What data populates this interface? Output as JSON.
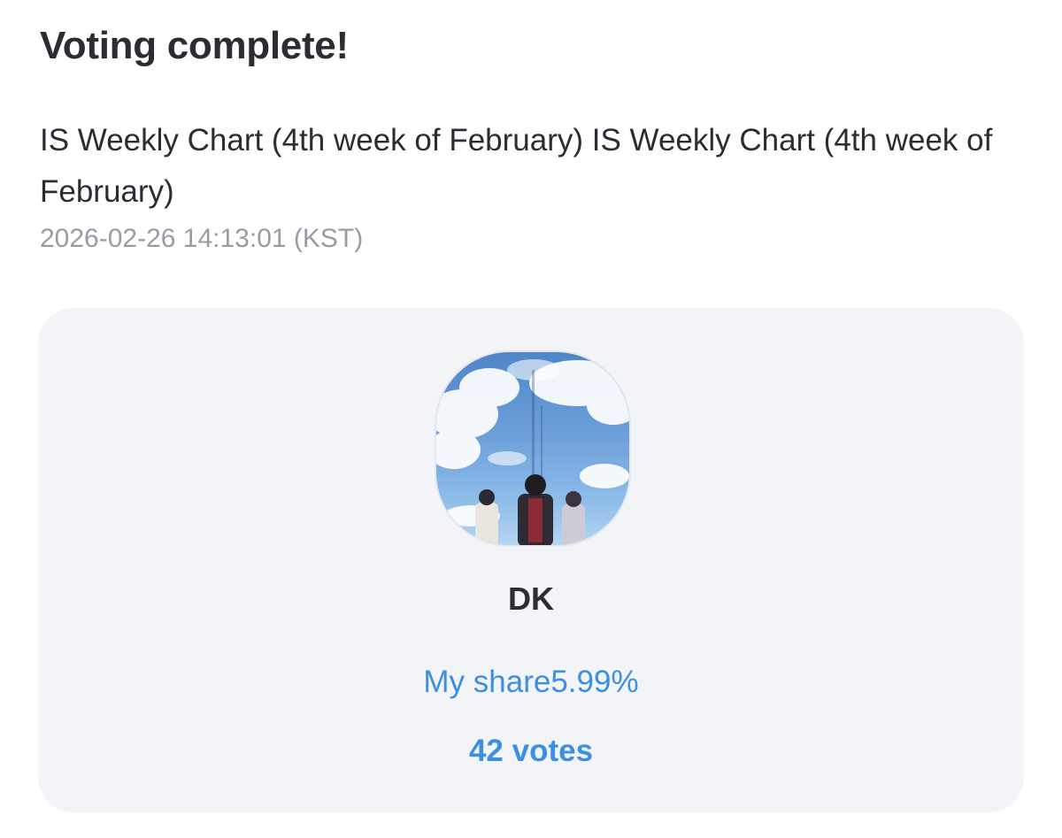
{
  "header": {
    "title": "Voting complete!"
  },
  "poll": {
    "title": "IS Weekly Chart (4th week of February) IS Weekly Chart (4th week of February)",
    "timestamp": "2026-02-26 14:13:01 (KST)"
  },
  "result": {
    "thumbnail_icon": "poster-image",
    "candidate_name": "DK",
    "share_label": "My share",
    "share_value": "5.99%",
    "votes_text": "42 votes"
  },
  "colors": {
    "accent": "#3d8fe3",
    "card_background": "#f3f4f7",
    "text_primary": "#2b2d33",
    "text_secondary": "#9a9ca3"
  }
}
